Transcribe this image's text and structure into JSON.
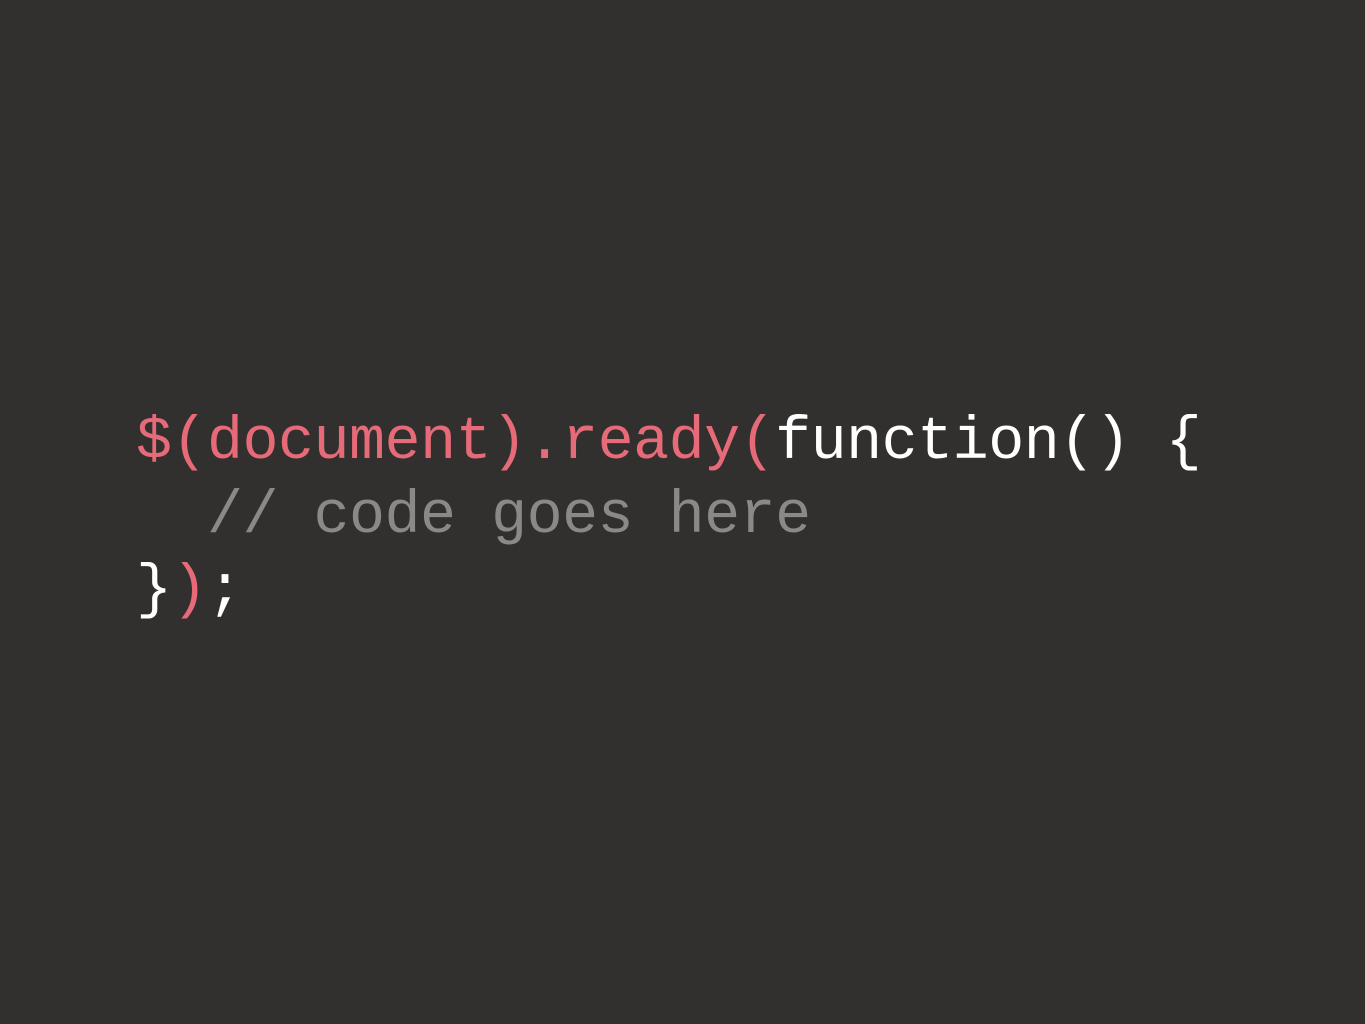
{
  "colors": {
    "background": "#31302f",
    "jquery_accent": "#e66a78",
    "plain_text": "#ffffff",
    "comment": "#8b8987"
  },
  "code": {
    "line1": {
      "dollar": "$",
      "paren_open": "(",
      "object": "document",
      "paren_close": ")",
      "dot": ".",
      "method": "ready",
      "call_open": "(",
      "keyword": "function",
      "params": "()",
      "brace_open": " {"
    },
    "line2": {
      "indent": "  ",
      "comment": "// code goes here"
    },
    "line3": {
      "brace_close": "}",
      "call_close": ")",
      "semicolon": ";"
    }
  }
}
